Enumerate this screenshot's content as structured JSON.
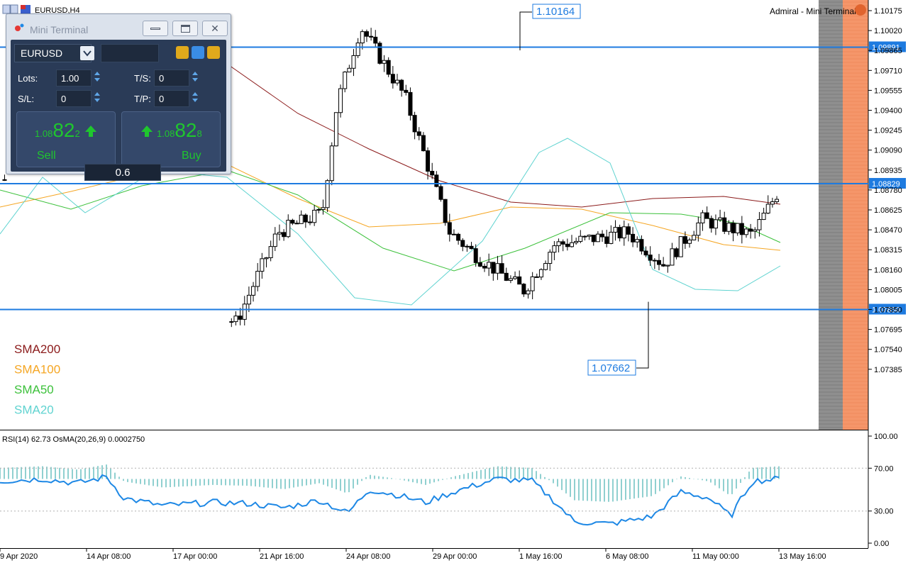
{
  "window": {
    "title": "EURUSD,H4",
    "broker_label": "Admiral - Mini Terminal"
  },
  "main_chart": {
    "price_ticks": [
      "1.10175",
      "1.10020",
      "1.09865",
      "1.09710",
      "1.09555",
      "1.09400",
      "1.09245",
      "1.09090",
      "1.08935",
      "1.08780",
      "1.08625",
      "1.08470",
      "1.08315",
      "1.08160",
      "1.08005",
      "1.07850",
      "1.07695",
      "1.07540",
      "1.07385"
    ],
    "time_ticks": [
      "9 Apr 2020",
      "14 Apr 08:00",
      "17 Apr 00:00",
      "21 Apr 16:00",
      "24 Apr 08:00",
      "29 Apr 00:00",
      "1 May 16:00",
      "6 May 08:00",
      "11 May 00:00",
      "13 May 16:00"
    ],
    "hlines": [
      {
        "label": "1.09891",
        "value": 1.09891
      },
      {
        "label": "1.08829",
        "value": 1.08829
      },
      {
        "label": "1.07850",
        "value": 1.0785
      }
    ],
    "annotations": [
      {
        "label": "1.10164",
        "value": 1.10164
      },
      {
        "label": "1.07662",
        "value": 1.07662
      }
    ],
    "legend": [
      {
        "name": "SMA200",
        "color": "#8b1a1a"
      },
      {
        "name": "SMA100",
        "color": "#f5a623"
      },
      {
        "name": "SMA50",
        "color": "#3cc13b"
      },
      {
        "name": "SMA20",
        "color": "#5fd3d0"
      }
    ]
  },
  "indicator": {
    "label": "RSI(14) 62.73 OsMA(20,26,9) 0.0002750",
    "ticks": [
      "100.00",
      "70.00",
      "30.00",
      "0.00"
    ],
    "rsi_color": "#1e88e5",
    "osma_color": "#20a0a0"
  },
  "mini_terminal": {
    "title": "Mini Terminal",
    "symbol": "EURUSD",
    "lots_label": "Lots:",
    "lots_value": "1.00",
    "ts_label": "T/S:",
    "ts_value": "0",
    "sl_label": "S/L:",
    "sl_value": "0",
    "tp_label": "T/P:",
    "tp_value": "0",
    "sell": {
      "price_small": "1.08",
      "price_big": "82",
      "price_tail": "2",
      "label": "Sell"
    },
    "buy": {
      "price_small": "1.08",
      "price_big": "82",
      "price_tail": "8",
      "label": "Buy"
    },
    "volume": "0.6"
  },
  "colors": {
    "hline": "#1e7be0",
    "accent_green": "#1fc62e",
    "bear": "#000000",
    "bull": "#ffffff"
  }
}
